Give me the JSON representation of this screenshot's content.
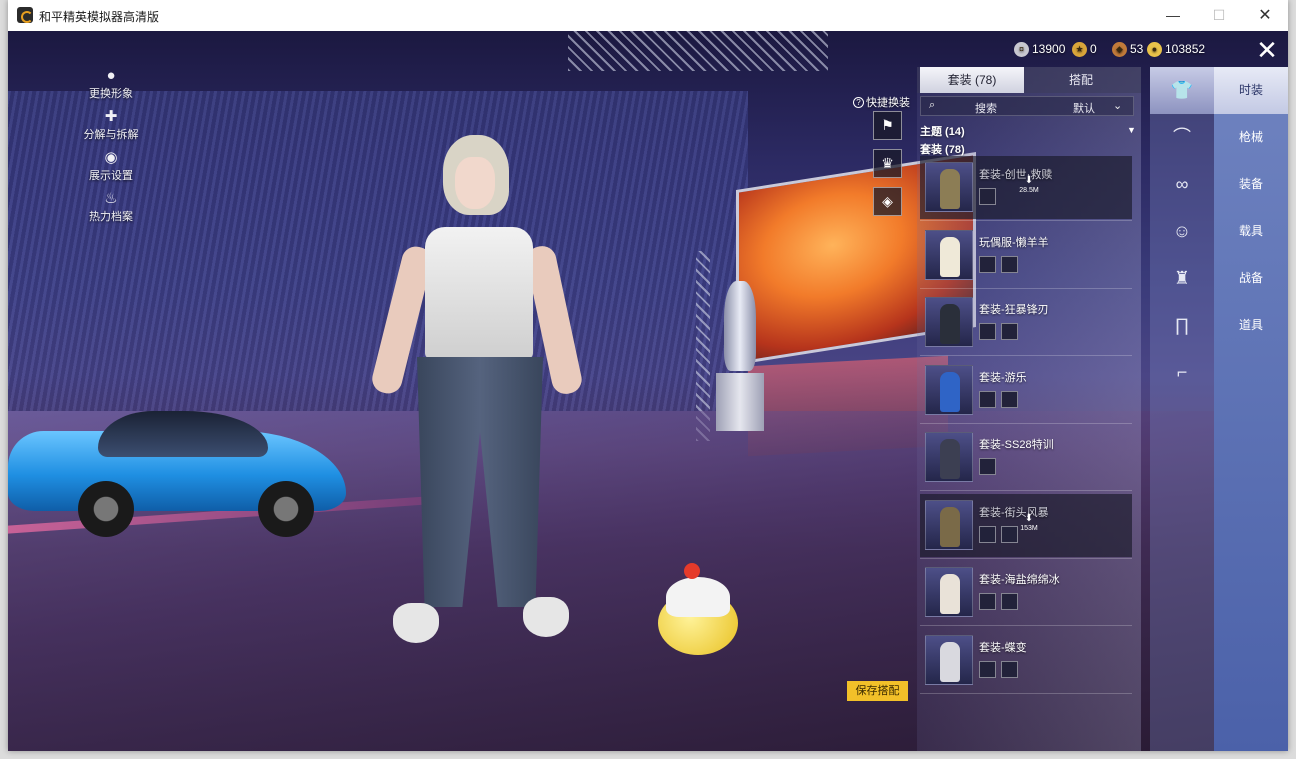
{
  "window": {
    "title": "和平精英模拟器高清版",
    "min": "—",
    "max": "☐",
    "close": "✕"
  },
  "left_menu": [
    {
      "label": "更换形象",
      "icon": "avatar-icon",
      "glyph": "●"
    },
    {
      "label": "分解与拆解",
      "icon": "puzzle-icon",
      "glyph": "✚"
    },
    {
      "label": "展示设置",
      "icon": "eye-icon",
      "glyph": "◉"
    },
    {
      "label": "热力档案",
      "icon": "flame-icon",
      "glyph": "♨"
    }
  ],
  "currencies": [
    {
      "value": "13900",
      "icon": "silver-coin-icon",
      "color": "#c8c8d0"
    },
    {
      "value": "0",
      "icon": "gold-badge-icon",
      "color": "#d9a53a"
    },
    {
      "value": "53",
      "icon": "bronze-coin-icon",
      "color": "#c07a3a"
    },
    {
      "value": "103852",
      "icon": "gold-coin-icon",
      "color": "#e8c24a"
    }
  ],
  "quick_change": {
    "label": "快捷换装",
    "help": "?"
  },
  "panel": {
    "tabs": {
      "active": "套装 (78)",
      "other": "搭配"
    },
    "search": {
      "placeholder": "搜索",
      "sort": "默认"
    },
    "groups": {
      "theme": "主题 (14)",
      "suits": "套装 (78)"
    },
    "items": [
      {
        "name": "套装-创世·救赎",
        "dim": true,
        "download": "28.5M",
        "minis": 1,
        "color": "#8c7d55"
      },
      {
        "name": "玩偶服-懒羊羊",
        "dim": false,
        "download": "",
        "minis": 2,
        "color": "#efe9d8"
      },
      {
        "name": "套装-狂暴锋刃",
        "dim": false,
        "download": "",
        "minis": 2,
        "color": "#2a2f3a"
      },
      {
        "name": "套装-游乐",
        "dim": false,
        "download": "",
        "minis": 2,
        "color": "#2f64c6"
      },
      {
        "name": "套装-SS28特训",
        "dim": false,
        "download": "",
        "minis": 1,
        "color": "#3c3f52"
      },
      {
        "name": "套装-街头风暴",
        "dim": true,
        "download": "153M",
        "minis": 2,
        "color": "#7a6a48"
      },
      {
        "name": "套装-海盐绵绵冰",
        "dim": false,
        "download": "",
        "minis": 2,
        "color": "#e9e2d8"
      },
      {
        "name": "套装-蝶变",
        "dim": false,
        "download": "",
        "minis": 2,
        "color": "#d9d9df"
      }
    ]
  },
  "categories": [
    {
      "icon": "outfit-icon",
      "glyph": "👕"
    },
    {
      "icon": "cap-icon",
      "glyph": "⌒"
    },
    {
      "icon": "goggles-icon",
      "glyph": "∞"
    },
    {
      "icon": "face-icon",
      "glyph": "☺"
    },
    {
      "icon": "jacket-icon",
      "glyph": "♜"
    },
    {
      "icon": "pants-icon",
      "glyph": "∏"
    },
    {
      "icon": "shoes-icon",
      "glyph": "⌐"
    }
  ],
  "right_nav": [
    "时装",
    "枪械",
    "装备",
    "载具",
    "战备",
    "道具"
  ],
  "save_button": "保存搭配",
  "close_game": "✕"
}
